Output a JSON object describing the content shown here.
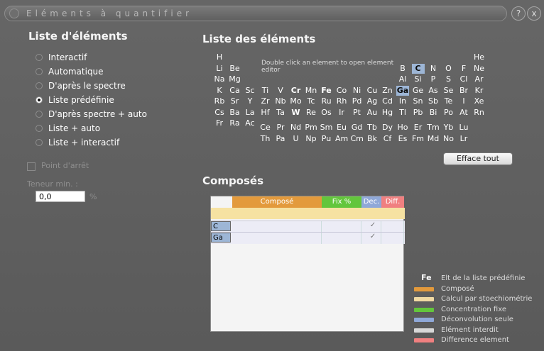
{
  "window": {
    "title": "Eléments à quantifier",
    "help_label": "?",
    "close_label": "x"
  },
  "left": {
    "heading": "Liste d'éléments",
    "radios": [
      {
        "label": "Interactif",
        "selected": false
      },
      {
        "label": "Automatique",
        "selected": false
      },
      {
        "label": "D'après le spectre",
        "selected": false
      },
      {
        "label": "Liste prédéfinie",
        "selected": true
      },
      {
        "label": "D'après spectre + auto",
        "selected": false
      },
      {
        "label": "Liste + auto",
        "selected": false
      },
      {
        "label": "Liste + interactif",
        "selected": false
      }
    ],
    "stop_point_label": "Point d'arrêt",
    "min_content_label": "Teneur min. :",
    "min_content_value": "0,0",
    "min_content_unit": "%"
  },
  "elements": {
    "heading": "Liste des éléments",
    "hint": "Double click an element to open element editor",
    "clear_all_label": "Efface tout",
    "selected": [
      "C",
      "Ga"
    ],
    "bolded": [
      "Cr",
      "Fe",
      "W"
    ],
    "rows": [
      [
        "H",
        "",
        "",
        "",
        "",
        "",
        "",
        "",
        "",
        "",
        "",
        "",
        "",
        "",
        "",
        "",
        "",
        "He"
      ],
      [
        "Li",
        "Be",
        "",
        "",
        "",
        "",
        "",
        "",
        "",
        "",
        "",
        "",
        "B",
        "C",
        "N",
        "O",
        "F",
        "Ne"
      ],
      [
        "Na",
        "Mg",
        "",
        "",
        "",
        "",
        "",
        "",
        "",
        "",
        "",
        "",
        "Al",
        "Si",
        "P",
        "S",
        "Cl",
        "Ar"
      ],
      [
        "K",
        "Ca",
        "Sc",
        "Ti",
        "V",
        "Cr",
        "Mn",
        "Fe",
        "Co",
        "Ni",
        "Cu",
        "Zn",
        "Ga",
        "Ge",
        "As",
        "Se",
        "Br",
        "Kr"
      ],
      [
        "Rb",
        "Sr",
        "Y",
        "Zr",
        "Nb",
        "Mo",
        "Tc",
        "Ru",
        "Rh",
        "Pd",
        "Ag",
        "Cd",
        "In",
        "Sn",
        "Sb",
        "Te",
        "I",
        "Xe"
      ],
      [
        "Cs",
        "Ba",
        "La",
        "Hf",
        "Ta",
        "W",
        "Re",
        "Os",
        "Ir",
        "Pt",
        "Au",
        "Hg",
        "Tl",
        "Pb",
        "Bi",
        "Po",
        "At",
        "Rn"
      ],
      [
        "Fr",
        "Ra",
        "Ac"
      ]
    ],
    "lanthanides": [
      "Ce",
      "Pr",
      "Nd",
      "Pm",
      "Sm",
      "Eu",
      "Gd",
      "Tb",
      "Dy",
      "Ho",
      "Er",
      "Tm",
      "Yb",
      "Lu"
    ],
    "actinides": [
      "Th",
      "Pa",
      "U",
      "Np",
      "Pu",
      "Am",
      "Cm",
      "Bk",
      "Cf",
      "Es",
      "Fm",
      "Md",
      "No",
      "Lr"
    ]
  },
  "compounds": {
    "heading": "Composés",
    "columns": [
      "Composé",
      "Fix %",
      "Dec.",
      "Diff."
    ],
    "column_colors": [
      "#e39a3c",
      "#63c63c",
      "#8fa8d8",
      "#f08080"
    ],
    "rows": [
      {
        "element": "C",
        "dec_check": "✓"
      },
      {
        "element": "Ga",
        "dec_check": "✓"
      }
    ]
  },
  "legend": [
    {
      "symbol": "Fe",
      "text": "Elt de la liste prédéfinie",
      "color": ""
    },
    {
      "symbol": "",
      "text": "Composé",
      "color": "#e39a3c"
    },
    {
      "symbol": "",
      "text": "Calcul par stoechiométrie",
      "color": "#f0d9a3"
    },
    {
      "symbol": "",
      "text": "Concentration fixe",
      "color": "#63c63c"
    },
    {
      "symbol": "",
      "text": "Déconvolution seule",
      "color": "#8fa8d8"
    },
    {
      "symbol": "",
      "text": "Elément interdit",
      "color": "#d8d8d8"
    },
    {
      "symbol": "",
      "text": "Difference element",
      "color": "#f08080"
    }
  ]
}
